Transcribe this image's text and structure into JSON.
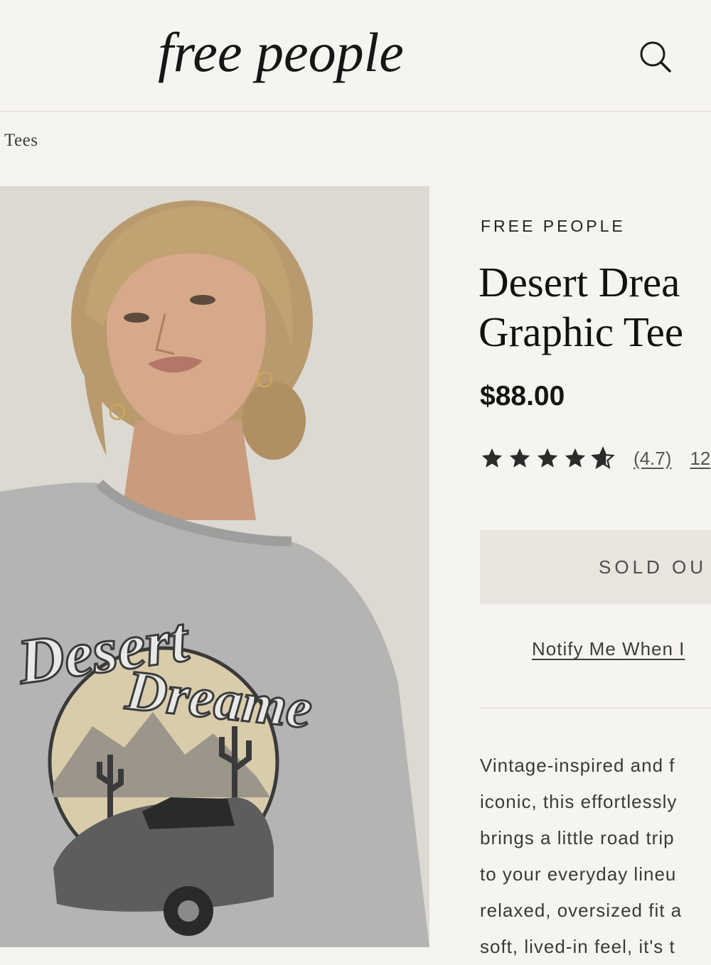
{
  "header": {
    "logo_text": "free people",
    "search_icon": "search-icon"
  },
  "breadcrumb": {
    "current": "Tees"
  },
  "product": {
    "brand": "FREE PEOPLE",
    "title_line1": "Desert Drea",
    "title_line2": "Graphic Tee",
    "price": "$88.00",
    "rating": {
      "stars": 4.7,
      "value_text": "(4.7)",
      "count_text": "12"
    },
    "sold_out_label": "SOLD OU",
    "notify_label": "Notify Me When I",
    "description_lines": [
      "Vintage-inspired and f",
      "iconic, this effortlessly",
      "brings a little road trip",
      "to your everyday lineu",
      "relaxed, oversized fit a",
      "soft, lived-in feel, it's t"
    ],
    "image": {
      "graphic_text_1": "Desert",
      "graphic_text_2": "Dreame"
    }
  },
  "colors": {
    "background": "#f6f4f0",
    "button_bg": "#e8e5df",
    "text": "#1f1f1f",
    "star": "#2b2b2b"
  }
}
